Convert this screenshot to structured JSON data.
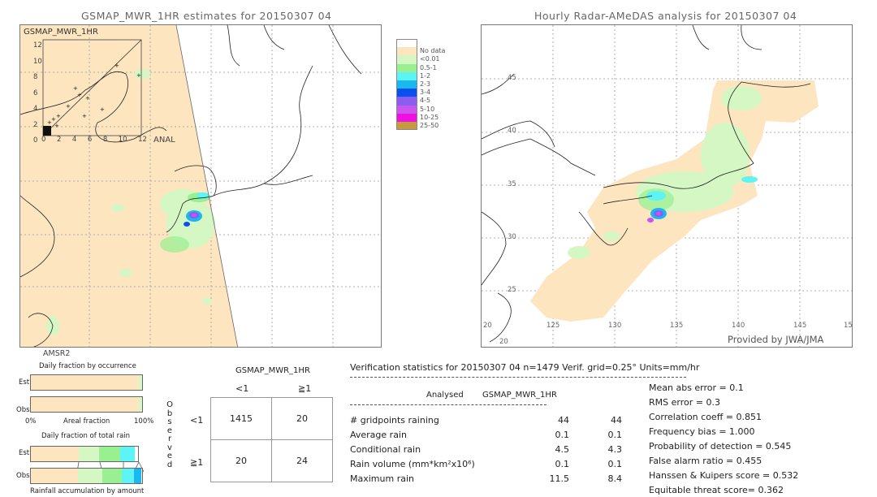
{
  "left_panel": {
    "title": "GSMAP_MWR_1HR estimates for 20150307 04",
    "inset_title": "GSMAP_MWR_1HR",
    "inset_xlabel": "ANAL",
    "inset_y_ticks": [
      "12",
      "10",
      "8",
      "6",
      "4",
      "2",
      "0"
    ],
    "inset_x_ticks": [
      "0",
      "2",
      "4",
      "6",
      "8",
      "10",
      "12"
    ],
    "sensor_label": "AMSR2"
  },
  "right_panel": {
    "title": "Hourly Radar-AMeDAS analysis for 20150307 04",
    "lat_labels": [
      "45",
      "40",
      "35",
      "30",
      "25",
      "20"
    ],
    "lon_labels": [
      "20",
      "125",
      "130",
      "135",
      "140",
      "145",
      "15"
    ],
    "credit": "Provided by JWA/JMA"
  },
  "legend": {
    "items": [
      {
        "label": "",
        "color": "#ffffff"
      },
      {
        "label": "No data",
        "color": "#fce5bf"
      },
      {
        "label": "<0.01",
        "color": "#d4f7c4"
      },
      {
        "label": "0.5-1",
        "color": "#99f090"
      },
      {
        "label": "1-2",
        "color": "#5cf4f4"
      },
      {
        "label": "2-3",
        "color": "#19b8f0"
      },
      {
        "label": "3-4",
        "color": "#0a50f0"
      },
      {
        "label": "4-5",
        "color": "#8a5ef0"
      },
      {
        "label": "5-10",
        "color": "#cc55f0"
      },
      {
        "label": "10-25",
        "color": "#f010e0"
      },
      {
        "label": "25-50",
        "color": "#c89a40"
      }
    ]
  },
  "occurrence_chart": {
    "title": "Daily fraction by occurrence",
    "est_label": "Est",
    "obs_label": "Obs",
    "axis_left": "0%",
    "axis_mid": "Areal fraction",
    "axis_right": "100%",
    "est_fractions": [
      0.97,
      0.03
    ],
    "obs_fractions": [
      0.97,
      0.03
    ]
  },
  "rain_chart": {
    "title": "Daily fraction of total rain",
    "est_label": "Est",
    "obs_label": "Obs",
    "footer": "Rainfall accumulation by amount",
    "est_fractions": [
      0.45,
      0.19,
      0.19,
      0.14
    ],
    "obs_fractions": [
      0.42,
      0.22,
      0.18,
      0.11,
      0.06
    ]
  },
  "contingency": {
    "title": "GSMAP_MWR_1HR",
    "col_headers": [
      "<1",
      "≧1"
    ],
    "row_headers": [
      "<1",
      "≧1"
    ],
    "side_label": [
      "O",
      "b",
      "s",
      "e",
      "r",
      "v",
      "e",
      "d"
    ],
    "cells": [
      [
        "1415",
        "20"
      ],
      [
        "20",
        "24"
      ]
    ]
  },
  "verification": {
    "header": "Verification statistics for 20150307 04   n=1479   Verif. grid=0.25°   Units=mm/hr",
    "col_analysed": "Analysed",
    "col_model": "GSMAP_MWR_1HR",
    "rows": [
      {
        "label": "# gridpoints raining",
        "analysed": "44",
        "model": "44"
      },
      {
        "label": "Average rain",
        "analysed": "0.1",
        "model": "0.1"
      },
      {
        "label": "Conditional rain",
        "analysed": "4.5",
        "model": "4.3"
      },
      {
        "label": "Rain volume (mm*km²x10⁶)",
        "analysed": "0.1",
        "model": "0.1"
      },
      {
        "label": "Maximum rain",
        "analysed": "11.5",
        "model": "8.4"
      }
    ],
    "scores": [
      "Mean abs error = 0.1",
      "RMS error = 0.3",
      "Correlation coeff = 0.851",
      "Frequency bias = 1.000",
      "Probability of detection = 0.545",
      "False alarm ratio = 0.455",
      "Hanssen & Kuipers score = 0.532",
      "Equitable threat score= 0.362"
    ]
  }
}
